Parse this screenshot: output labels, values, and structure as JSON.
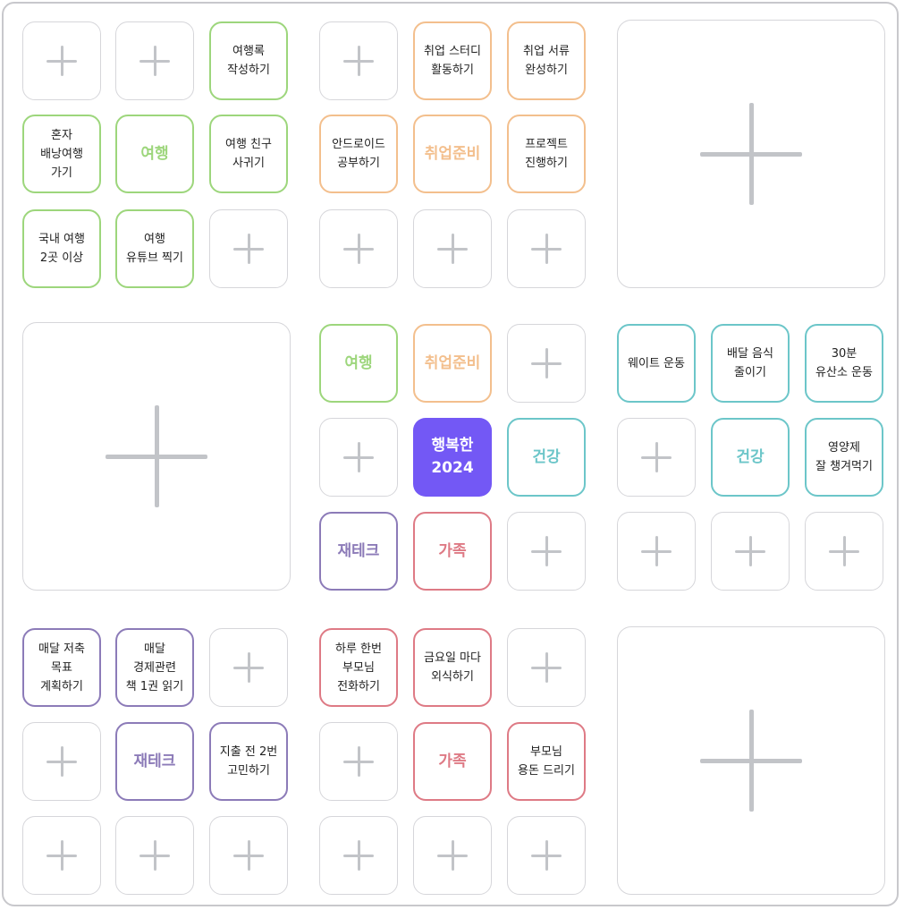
{
  "colors": {
    "travel": "#9dd67c",
    "career": "#f3bf8d",
    "health": "#6cc6c9",
    "finance": "#8c7bb8",
    "family": "#de7a85",
    "main": "#7358f5",
    "empty_border": "#d6d6da",
    "plus": "#c2c4c8"
  },
  "icons": {
    "empty": "plus-icon"
  },
  "main_goal": {
    "text": "행복한\n2024"
  },
  "core_goals": [
    {
      "key": "travel",
      "text": "여행"
    },
    {
      "key": "career",
      "text": "취업준비"
    },
    {
      "key": "health",
      "text": "건강"
    },
    {
      "key": "finance",
      "text": "재테크"
    },
    {
      "key": "family",
      "text": "가족"
    }
  ],
  "blocks": {
    "travel": {
      "center": "여행",
      "goals": [
        "여행록\n작성하기",
        "혼자\n배낭여행\n가기",
        "여행 친구\n사귀기",
        "국내 여행\n2곳 이상",
        "여행\n유튜브 찍기"
      ]
    },
    "career": {
      "center": "취업준비",
      "goals": [
        "취업 스터디\n활동하기",
        "취업 서류\n완성하기",
        "안드로이드\n공부하기",
        "프로젝트\n진행하기"
      ]
    },
    "health": {
      "center": "건강",
      "goals": [
        "웨이트 운동",
        "배달 음식\n줄이기",
        "30분\n유산소 운동",
        "영양제\n잘 챙겨먹기"
      ]
    },
    "finance": {
      "center": "재테크",
      "goals": [
        "매달 저축\n목표\n계획하기",
        "매달\n경제관련\n책 1권 읽기",
        "지출 전 2번\n고민하기"
      ]
    },
    "family": {
      "center": "가족",
      "goals": [
        "하루 한번\n부모님\n전화하기",
        "금요일 마다\n외식하기",
        "부모님\n용돈 드리기"
      ]
    }
  }
}
